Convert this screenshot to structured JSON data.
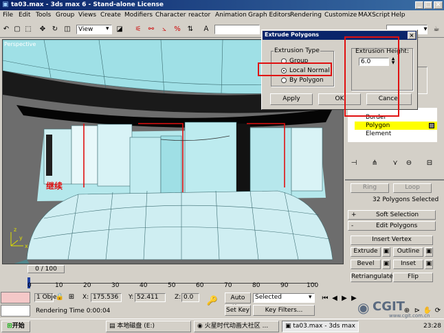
{
  "window": {
    "title": "ta03.max - 3ds max 6 - Stand-alone License"
  },
  "menu": [
    "File",
    "Edit",
    "Tools",
    "Group",
    "Views",
    "Create",
    "Modifiers",
    "Character",
    "reactor",
    "Animation",
    "Graph Editors",
    "Rendering",
    "Customize",
    "MAXScript",
    "Help"
  ],
  "toolbar": {
    "view_select": "View"
  },
  "viewport": {
    "label": "Perspective",
    "annotation": "继续"
  },
  "dialog": {
    "title": "Extrude Polygons",
    "extrusion_type_label": "Extrusion Type",
    "options": [
      "Group",
      "Local Normal",
      "By Polygon"
    ],
    "selected": "Local Normal",
    "height_label": "Extrusion Height:",
    "height_value": "6.0",
    "apply": "Apply",
    "ok": "OK",
    "cancel": "Cancel"
  },
  "subobjects": [
    "Border",
    "Polygon",
    "Element"
  ],
  "subobject_selected": "Polygon",
  "selection": {
    "ring": "Ring",
    "loop": "Loop",
    "status": "32 Polygons Selected"
  },
  "rollouts": {
    "soft_selection": "Soft Selection",
    "edit_polygons": "Edit Polygons",
    "plus": "+",
    "minus": "-"
  },
  "edit_buttons": {
    "insert_vertex": "Insert Vertex",
    "extrude": "Extrude",
    "outline": "Outline",
    "bevel": "Bevel",
    "inset": "Inset",
    "retriangulate": "Retriangulate",
    "flip": "Flip"
  },
  "timeslider": {
    "label": "0 / 100"
  },
  "ruler_ticks": [
    "0",
    "10",
    "20",
    "30",
    "40",
    "50",
    "60",
    "70",
    "80",
    "90",
    "100"
  ],
  "status": {
    "objects": "1 Obje",
    "x_label": "X:",
    "x_value": "175.536",
    "y_label": "Y:",
    "y_value": "52.411",
    "z_label": "Z:",
    "z_value": "0.0",
    "auto_key": "Auto Key",
    "selected": "Selected",
    "set_key": "Set Key",
    "key_filters": "Key Filters...",
    "rendering_time": "Rendering Time  0:00:04"
  },
  "taskbar": {
    "start": "开始",
    "items": [
      "本地磁盘 (E:)",
      "火星时代动画大社区 ...",
      "ta03.max - 3ds max 6"
    ],
    "time": "23:28"
  },
  "watermark": {
    "brand": "CGIT",
    "url": "www.cgit.com.cn"
  },
  "colors": {
    "title_bar": "#0a246a",
    "highlight": "#ffff00",
    "red_box": "#e01010",
    "mesh": "#8ed8e0"
  }
}
